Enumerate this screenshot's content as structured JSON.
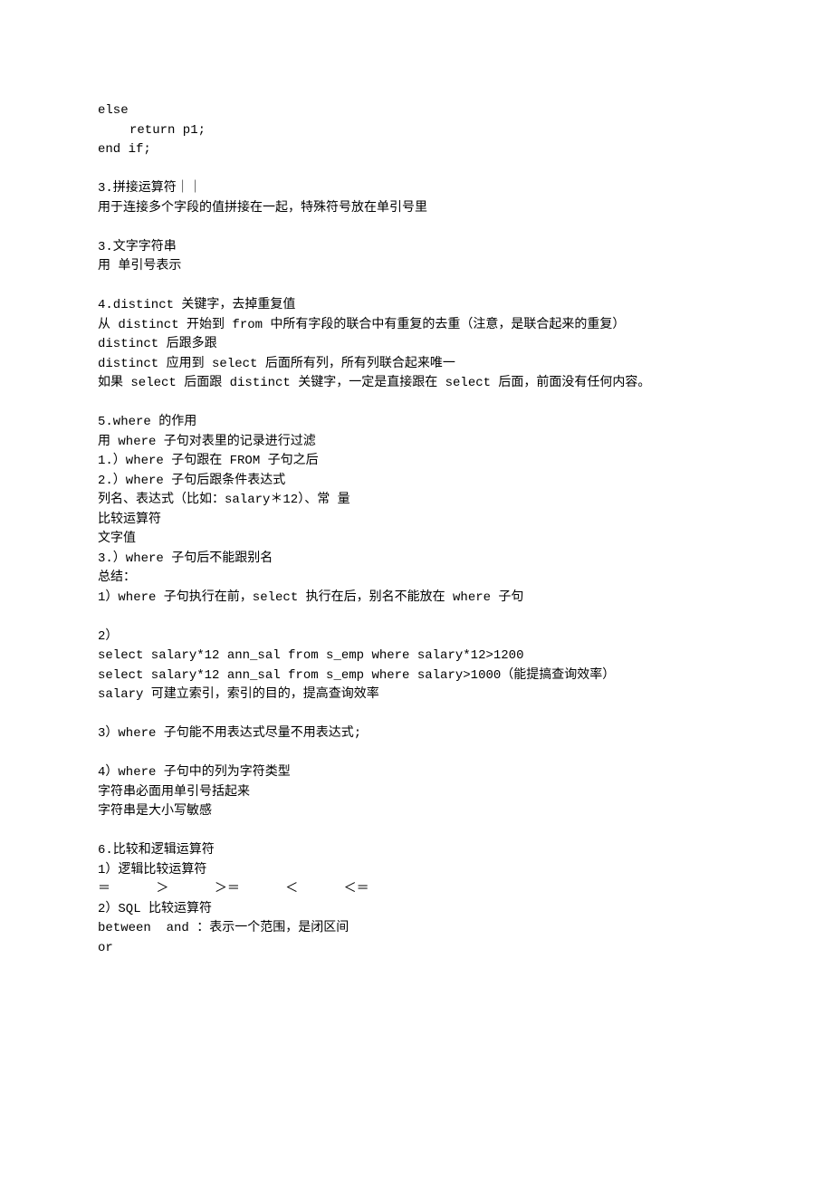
{
  "lines": [
    {
      "text": "else",
      "cls": ""
    },
    {
      "text": "return p1;",
      "cls": "indent"
    },
    {
      "text": "end if;",
      "cls": ""
    },
    {
      "text": "",
      "cls": ""
    },
    {
      "text": "3.拼接运算符｜｜",
      "cls": ""
    },
    {
      "text": "用于连接多个字段的值拼接在一起，特殊符号放在单引号里",
      "cls": ""
    },
    {
      "text": "",
      "cls": ""
    },
    {
      "text": "3.文字字符串",
      "cls": ""
    },
    {
      "text": "用 单引号表示",
      "cls": ""
    },
    {
      "text": "",
      "cls": ""
    },
    {
      "text": "4.distinct 关键字，去掉重复值",
      "cls": ""
    },
    {
      "text": "从 distinct 开始到 from 中所有字段的联合中有重复的去重（注意，是联合起来的重复）",
      "cls": ""
    },
    {
      "text": "distinct 后跟多跟",
      "cls": ""
    },
    {
      "text": "distinct 应用到 select 后面所有列，所有列联合起来唯一",
      "cls": ""
    },
    {
      "text": "如果 select 后面跟 distinct 关键字，一定是直接跟在 select 后面，前面没有任何内容。",
      "cls": ""
    },
    {
      "text": "",
      "cls": ""
    },
    {
      "text": "5.where 的作用",
      "cls": ""
    },
    {
      "text": "用 where 子句对表里的记录进行过滤",
      "cls": ""
    },
    {
      "text": "1.）where 子句跟在 FROM 子句之后",
      "cls": ""
    },
    {
      "text": "2.）where 子句后跟条件表达式",
      "cls": ""
    },
    {
      "text": "列名、表达式（比如：salary＊12）、常 量",
      "cls": ""
    },
    {
      "text": "比较运算符",
      "cls": ""
    },
    {
      "text": "文字值",
      "cls": ""
    },
    {
      "text": "3.）where 子句后不能跟别名",
      "cls": ""
    },
    {
      "text": "总结：",
      "cls": ""
    },
    {
      "text": "1）where 子句执行在前，select 执行在后，别名不能放在 where 子句",
      "cls": ""
    },
    {
      "text": "",
      "cls": ""
    },
    {
      "text": "2）",
      "cls": ""
    },
    {
      "text": "select salary*12 ann_sal from s_emp where salary*12>1200",
      "cls": ""
    },
    {
      "text": "select salary*12 ann_sal from s_emp where salary>1000（能提搞查询效率）",
      "cls": ""
    },
    {
      "text": "salary 可建立索引，索引的目的，提高查询效率",
      "cls": ""
    },
    {
      "text": "",
      "cls": ""
    },
    {
      "text": "3）where 子句能不用表达式尽量不用表达式;",
      "cls": ""
    },
    {
      "text": "",
      "cls": ""
    },
    {
      "text": "4）where 子句中的列为字符类型",
      "cls": ""
    },
    {
      "text": "字符串必面用单引号括起来",
      "cls": ""
    },
    {
      "text": "字符串是大小写敏感",
      "cls": ""
    },
    {
      "text": "",
      "cls": ""
    },
    {
      "text": "6.比较和逻辑运算符",
      "cls": ""
    },
    {
      "text": "1）逻辑比较运算符",
      "cls": ""
    },
    {
      "text": "＝      ＞      ＞＝      ＜      ＜＝",
      "cls": ""
    },
    {
      "text": "2）SQL 比较运算符",
      "cls": ""
    },
    {
      "text": "between  and ：表示一个范围，是闭区间",
      "cls": ""
    },
    {
      "text": "or",
      "cls": ""
    }
  ]
}
